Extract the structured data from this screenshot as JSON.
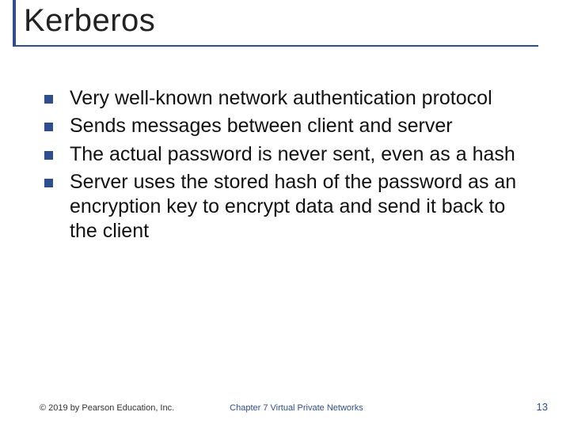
{
  "title": "Kerberos",
  "bullets": {
    "b0": "Very well-known network authentication protocol",
    "b1": "Sends messages between client and server",
    "b2": "The actual password is never sent, even as a hash",
    "b3": "Server uses the stored hash of the password as an encryption key to encrypt data and send it back to the client"
  },
  "footer": {
    "copyright": "© 2019 by Pearson Education, Inc.",
    "chapter": "Chapter 7  Virtual Private Networks",
    "page": "13"
  }
}
